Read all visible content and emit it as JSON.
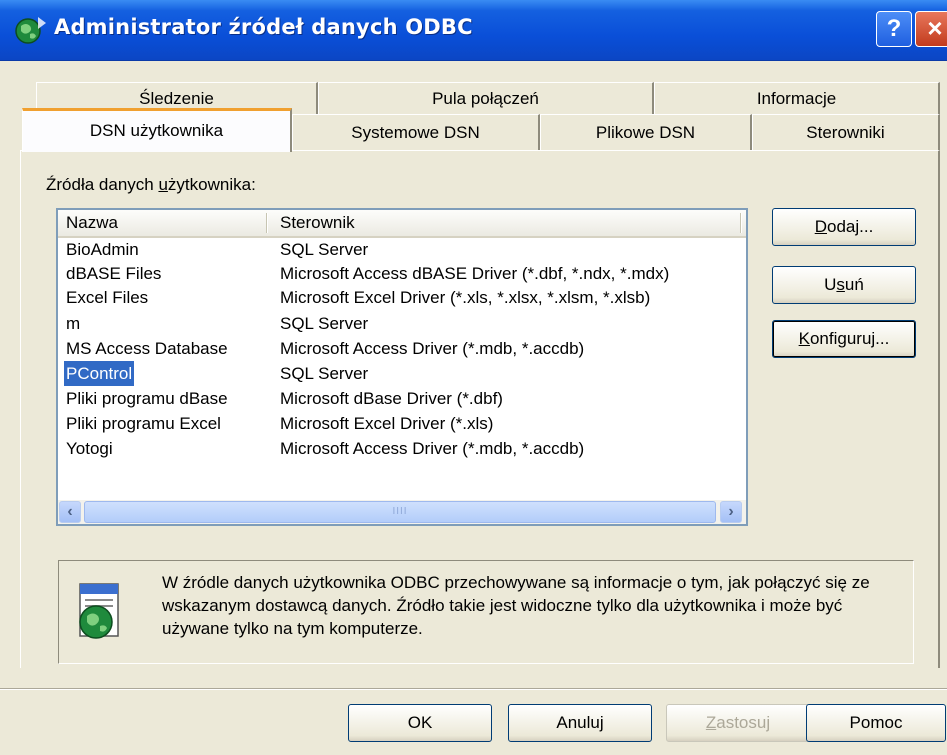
{
  "window": {
    "title": "Administrator źródeł danych ODBC",
    "help_label": "?",
    "close_label": "×"
  },
  "tabs_back": [
    {
      "label": "Śledzenie"
    },
    {
      "label": "Pula połączeń"
    },
    {
      "label": "Informacje"
    }
  ],
  "tabs_front": [
    {
      "label": "DSN użytkownika",
      "selected": true
    },
    {
      "label": "Systemowe DSN"
    },
    {
      "label": "Plikowe DSN"
    },
    {
      "label": "Sterowniki"
    }
  ],
  "section": {
    "label_pre": "Źródła danych ",
    "label_u": "u",
    "label_post": "żytkownika:"
  },
  "list": {
    "columns": [
      "Nazwa",
      "Sterownik"
    ],
    "rows": [
      {
        "name": "BioAdmin",
        "driver": "SQL Server"
      },
      {
        "name": "dBASE Files",
        "driver": "Microsoft Access dBASE Driver (*.dbf, *.ndx, *.mdx)"
      },
      {
        "name": "Excel Files",
        "driver": "Microsoft Excel Driver (*.xls, *.xlsx, *.xlsm, *.xlsb)"
      },
      {
        "name": "m",
        "driver": "SQL Server"
      },
      {
        "name": "MS Access Database",
        "driver": "Microsoft Access Driver (*.mdb, *.accdb)"
      },
      {
        "name": "PControl",
        "driver": "SQL Server",
        "selected": true
      },
      {
        "name": "Pliki programu dBase",
        "driver": "Microsoft dBase Driver (*.dbf)"
      },
      {
        "name": "Pliki programu Excel",
        "driver": "Microsoft Excel Driver (*.xls)"
      },
      {
        "name": "Yotogi",
        "driver": "Microsoft Access Driver (*.mdb, *.accdb)"
      }
    ],
    "scroll_left": "‹",
    "scroll_right": "›",
    "thumb_grip": "IIII"
  },
  "side_buttons": {
    "add": {
      "u": "D",
      "rest": "odaj..."
    },
    "remove": {
      "pre": "U",
      "u": "s",
      "rest": "uń"
    },
    "configure": {
      "u": "K",
      "rest": "onfiguruj..."
    }
  },
  "info": {
    "text": "W źródle danych użytkownika ODBC przechowywane są informacje o tym, jak połączyć się ze wskazanym dostawcą danych. Źródło takie jest widoczne tylko dla użytkownika i może być używane tylko na tym komputerze."
  },
  "footer": {
    "ok": "OK",
    "cancel": "Anuluj",
    "apply_u": "Z",
    "apply_rest": "astosuj",
    "help": "Pomoc"
  },
  "icons": {
    "app": "odbc-globe-icon",
    "info": "odbc-datasource-icon"
  },
  "colors": {
    "titlebar": "#0a4fd8",
    "selection": "#316ac5",
    "face": "#ece9d8"
  }
}
